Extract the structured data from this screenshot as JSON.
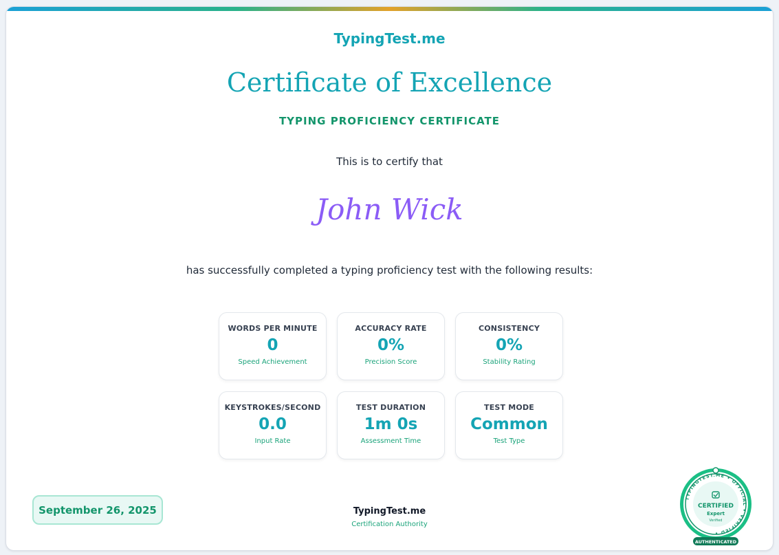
{
  "brand": "TypingTest.me",
  "title": "Certificate of Excellence",
  "subtitle": "TYPING PROFICIENCY CERTIFICATE",
  "certify_text": "This is to certify that",
  "recipient_name": "John Wick",
  "completed_text": "has successfully completed a typing proficiency test with the following results:",
  "stats": [
    {
      "label": "WORDS PER MINUTE",
      "value": "0",
      "caption": "Speed Achievement"
    },
    {
      "label": "ACCURACY RATE",
      "value": "0%",
      "caption": "Precision Score"
    },
    {
      "label": "CONSISTENCY",
      "value": "0%",
      "caption": "Stability Rating"
    },
    {
      "label": "KEYSTROKES/SECOND",
      "value": "0.0",
      "caption": "Input Rate"
    },
    {
      "label": "TEST DURATION",
      "value": "1m 0s",
      "caption": "Assessment Time"
    },
    {
      "label": "TEST MODE",
      "value": "Common",
      "caption": "Test Type"
    }
  ],
  "date": "September 26, 2025",
  "authority": {
    "name": "TypingTest.me",
    "role": "Certification Authority"
  },
  "seal": {
    "ring_text": "TYPINGTEST.ME • OFFICIAL • VERIFIED •",
    "certified": "CERTIFIED",
    "level": "Expert",
    "verified": "Verified",
    "authenticated": "AUTHENTICATED",
    "icon": "checkbox-icon"
  },
  "colors": {
    "teal": "#14a4b4",
    "green": "#13956b",
    "violet": "#8b5cf6"
  }
}
